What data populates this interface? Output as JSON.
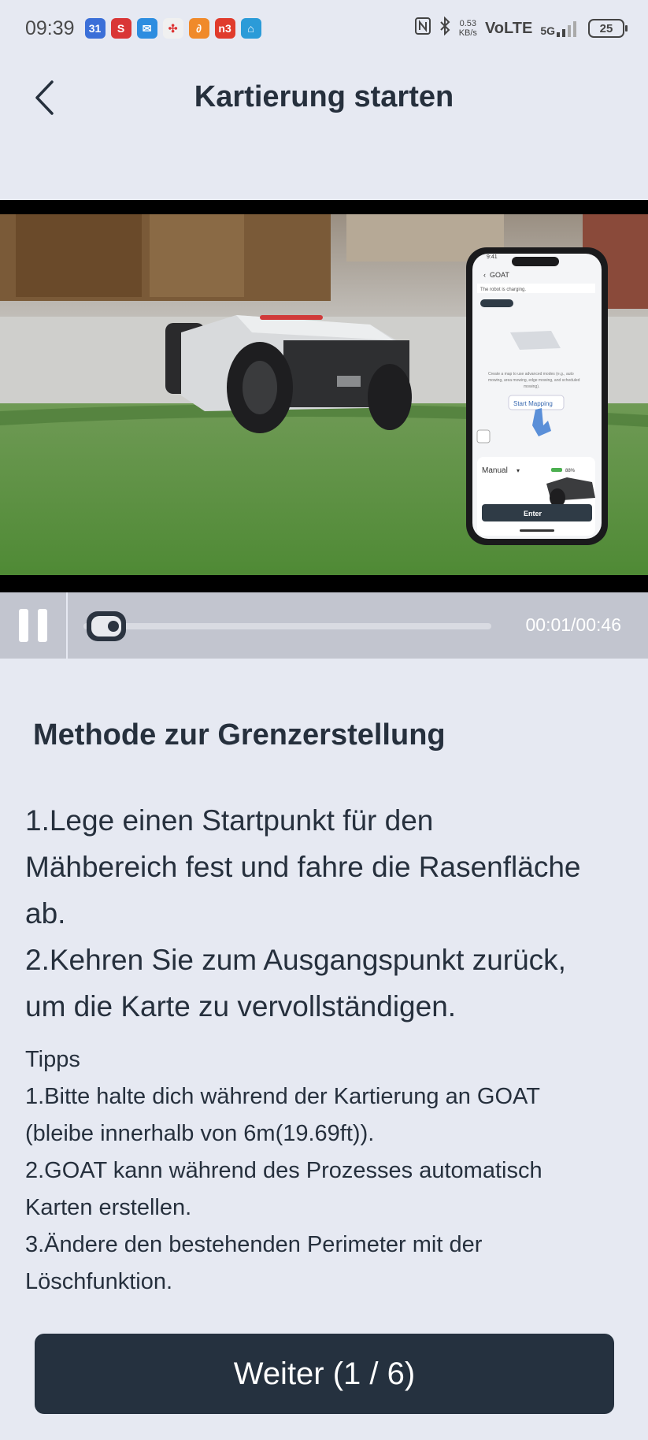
{
  "status_bar": {
    "time": "09:39",
    "notification_icons": [
      {
        "name": "calendar-icon",
        "text": "31",
        "color": "#3b6fd8"
      },
      {
        "name": "s-app-icon",
        "text": "S",
        "color": "#d93636"
      },
      {
        "name": "mail-icon",
        "text": "✉",
        "color": "#2d8de0"
      },
      {
        "name": "slack-icon",
        "text": "✣",
        "color": "#f0f0f0"
      },
      {
        "name": "paperclip-app-icon",
        "text": "∂",
        "color": "#f08a2a"
      },
      {
        "name": "ms-app-icon",
        "text": "n3",
        "color": "#e03b2c"
      },
      {
        "name": "home-app-icon",
        "text": "⌂",
        "color": "#2b9bd8"
      }
    ],
    "net_speed_value": "0.53",
    "net_speed_unit": "KB/s",
    "volte": "VoLTE",
    "network": "5G",
    "battery": "25"
  },
  "header": {
    "title": "Kartierung starten"
  },
  "video": {
    "time": "00:01/00:46",
    "progress": 0.02,
    "phone_ui": {
      "time": "9:41",
      "app_name": "GOAT",
      "status": "The robot is charging.",
      "description": "Create a map to use advanced modes (e.g., auto mowing, area mowing, edge mowing, and scheduled mowing).",
      "start_mapping": "Start Mapping",
      "mode": "Manual",
      "battery": "88%",
      "enter": "Enter"
    }
  },
  "content": {
    "section_title": "Methode zur Grenzerstellung",
    "steps": [
      "1.Lege einen Startpunkt für den",
      "Mähbereich fest und fahre die Rasenfläche",
      "ab.",
      "2.Kehren Sie zum Ausgangspunkt zurück,",
      "um die Karte zu vervollständigen."
    ],
    "tips": [
      "Tipps",
      "1.Bitte halte dich während der Kartierung an GOAT",
      "(bleibe innerhalb von 6m(19.69ft)).",
      "2.GOAT kann während des Prozesses automatisch",
      "Karten erstellen.",
      "3.Ändere den bestehenden Perimeter mit der",
      "Löschfunktion."
    ]
  },
  "footer": {
    "next_label": "Weiter (1 / 6)"
  }
}
